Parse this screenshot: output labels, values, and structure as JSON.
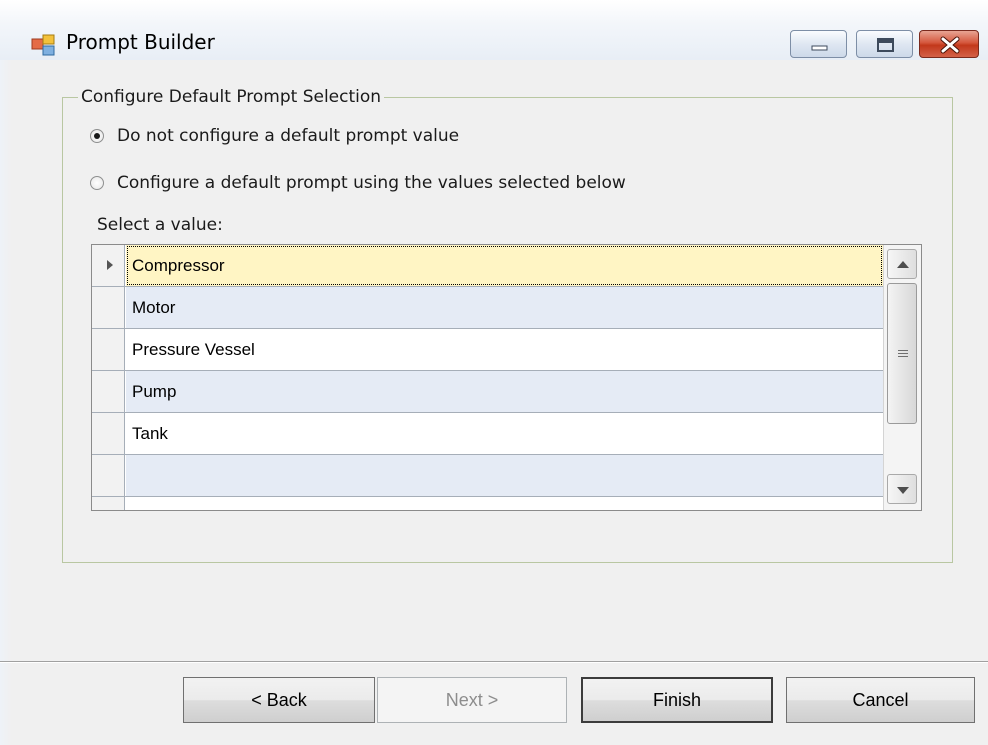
{
  "window": {
    "title": "Prompt Builder"
  },
  "group": {
    "legend": "Configure Default Prompt Selection",
    "options": [
      {
        "label": "Do not configure a default prompt value",
        "checked": true
      },
      {
        "label": "Configure a default prompt using the values selected below",
        "checked": false
      }
    ],
    "select_label": "Select a value:"
  },
  "grid": {
    "rows": [
      "Compressor",
      "Motor",
      "Pressure Vessel",
      "Pump",
      "Tank",
      ""
    ],
    "selected_index": 0
  },
  "buttons": {
    "back": "< Back",
    "next": "Next >",
    "finish": "Finish",
    "cancel": "Cancel"
  },
  "colors": {
    "selected_row": "#fff5c4",
    "alt_row": "#e5ebf5",
    "close_button": "#c2381b"
  }
}
